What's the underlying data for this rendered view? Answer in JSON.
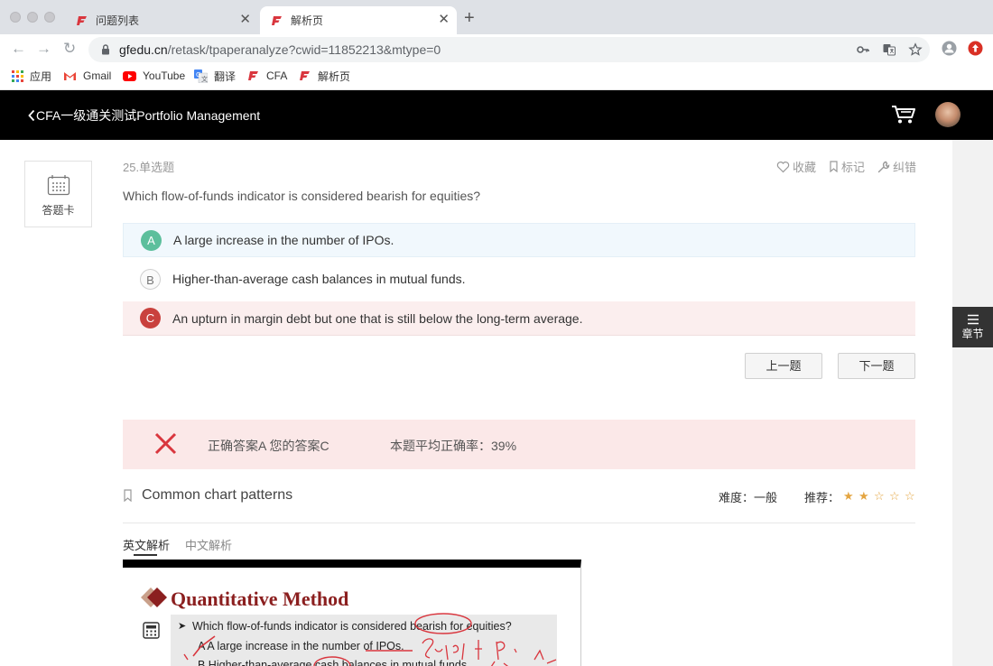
{
  "browser": {
    "tabs": [
      {
        "title": "问题列表",
        "active": false
      },
      {
        "title": "解析页",
        "active": true
      }
    ],
    "new_tab": "+",
    "url": {
      "host": "gfedu.cn",
      "path": "/retask/tpaperanalyze?cwid=11852213&mtype=0"
    },
    "bookmarks": [
      "应用",
      "Gmail",
      "YouTube",
      "翻译",
      "CFA",
      "解析页"
    ]
  },
  "header": {
    "title": "CFA一级通关测试Portfolio Management"
  },
  "sidebar": {
    "answer_card": "答题卡",
    "chapter": "章节"
  },
  "question": {
    "number": "25.单选题",
    "text": "Which flow-of-funds indicator is considered bearish for equities?",
    "actions": [
      "收藏",
      "标记",
      "纠错"
    ],
    "options": [
      {
        "letter": "A",
        "text": "A large increase in the number of IPOs.",
        "state": "correct"
      },
      {
        "letter": "B",
        "text": "Higher-than-average cash balances in mutual funds.",
        "state": "normal"
      },
      {
        "letter": "C",
        "text": "An upturn in margin debt but one that is still below the long-term average.",
        "state": "wrong"
      }
    ],
    "prev": "上一题",
    "next": "下一题"
  },
  "result": {
    "answer_text": "正确答案A 您的答案C",
    "accuracy_text": "本题平均正确率：39%",
    "accuracy_percent": 39
  },
  "knowledge": {
    "topic": "Common chart patterns",
    "difficulty_label": "难度：",
    "difficulty_value": "一般",
    "recommend_label": "推荐：",
    "stars_filled": 2,
    "stars_total": 5
  },
  "analysis_tabs": [
    "英文解析",
    "中文解析"
  ],
  "slide": {
    "title": "Quantitative Method",
    "question": "Which flow-of-funds indicator is considered bearish for equities?",
    "option_a": "A   A large increase in the number of IPOs.",
    "option_b": "B   Higher-than-average cash balances in mutual funds"
  },
  "colors": {
    "header_bg": "#000000",
    "correct": "#5cbf9c",
    "wrong": "#c9413d",
    "star": "#e4a541",
    "slide_title": "#8b1f1f"
  }
}
